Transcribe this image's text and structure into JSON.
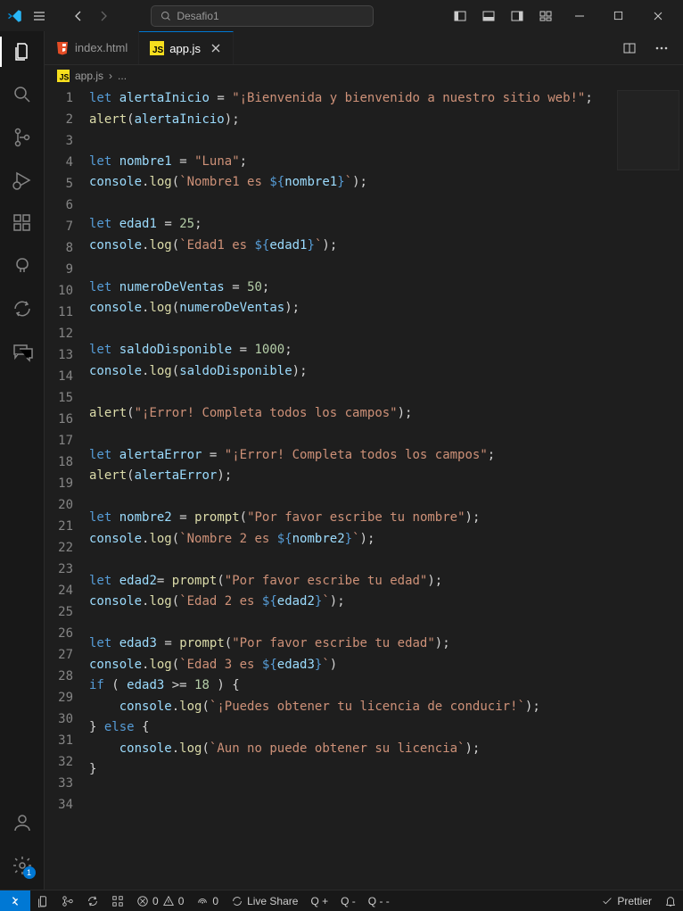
{
  "titlebar": {
    "search_text": "Desafio1"
  },
  "tabs": {
    "items": [
      {
        "label": "index.html",
        "type": "html"
      },
      {
        "label": "app.js",
        "type": "js"
      }
    ]
  },
  "breadcrumb": {
    "file": "app.js",
    "sep": "›",
    "rest": "..."
  },
  "code_lines": [
    {
      "n": 1,
      "tokens": [
        [
          "key",
          "let"
        ],
        [
          "pun",
          " "
        ],
        [
          "var",
          "alertaInicio"
        ],
        [
          "pun",
          " "
        ],
        [
          "op",
          "="
        ],
        [
          "pun",
          " "
        ],
        [
          "str",
          "\"¡Bienvenida y bienvenido a nuestro sitio web!\""
        ],
        [
          "pun",
          ";"
        ]
      ]
    },
    {
      "n": 2,
      "tokens": [
        [
          "fn",
          "alert"
        ],
        [
          "pun",
          "("
        ],
        [
          "var",
          "alertaInicio"
        ],
        [
          "pun",
          ")"
        ],
        [
          "pun",
          ";"
        ]
      ]
    },
    {
      "n": 3,
      "tokens": []
    },
    {
      "n": 4,
      "tokens": [
        [
          "key",
          "let"
        ],
        [
          "pun",
          " "
        ],
        [
          "var",
          "nombre1"
        ],
        [
          "pun",
          " "
        ],
        [
          "op",
          "="
        ],
        [
          "pun",
          " "
        ],
        [
          "str",
          "\"Luna\""
        ],
        [
          "pun",
          ";"
        ]
      ]
    },
    {
      "n": 5,
      "tokens": [
        [
          "var",
          "console"
        ],
        [
          "pun",
          "."
        ],
        [
          "fn",
          "log"
        ],
        [
          "pun",
          "("
        ],
        [
          "str",
          "`Nombre1 es "
        ],
        [
          "key",
          "${"
        ],
        [
          "var",
          "nombre1"
        ],
        [
          "key",
          "}"
        ],
        [
          "str",
          "`"
        ],
        [
          "pun",
          ")"
        ],
        [
          "pun",
          ";"
        ]
      ]
    },
    {
      "n": 6,
      "tokens": []
    },
    {
      "n": 7,
      "tokens": [
        [
          "key",
          "let"
        ],
        [
          "pun",
          " "
        ],
        [
          "var",
          "edad1"
        ],
        [
          "pun",
          " "
        ],
        [
          "op",
          "="
        ],
        [
          "pun",
          " "
        ],
        [
          "num",
          "25"
        ],
        [
          "pun",
          ";"
        ]
      ]
    },
    {
      "n": 8,
      "tokens": [
        [
          "var",
          "console"
        ],
        [
          "pun",
          "."
        ],
        [
          "fn",
          "log"
        ],
        [
          "pun",
          "("
        ],
        [
          "str",
          "`Edad1 es "
        ],
        [
          "key",
          "${"
        ],
        [
          "var",
          "edad1"
        ],
        [
          "key",
          "}"
        ],
        [
          "str",
          "`"
        ],
        [
          "pun",
          ")"
        ],
        [
          "pun",
          ";"
        ]
      ]
    },
    {
      "n": 9,
      "tokens": []
    },
    {
      "n": 10,
      "tokens": [
        [
          "key",
          "let"
        ],
        [
          "pun",
          " "
        ],
        [
          "var",
          "numeroDeVentas"
        ],
        [
          "pun",
          " "
        ],
        [
          "op",
          "="
        ],
        [
          "pun",
          " "
        ],
        [
          "num",
          "50"
        ],
        [
          "pun",
          ";"
        ]
      ]
    },
    {
      "n": 11,
      "tokens": [
        [
          "var",
          "console"
        ],
        [
          "pun",
          "."
        ],
        [
          "fn",
          "log"
        ],
        [
          "pun",
          "("
        ],
        [
          "var",
          "numeroDeVentas"
        ],
        [
          "pun",
          ")"
        ],
        [
          "pun",
          ";"
        ]
      ]
    },
    {
      "n": 12,
      "tokens": []
    },
    {
      "n": 13,
      "tokens": [
        [
          "key",
          "let"
        ],
        [
          "pun",
          " "
        ],
        [
          "var",
          "saldoDisponible"
        ],
        [
          "pun",
          " "
        ],
        [
          "op",
          "="
        ],
        [
          "pun",
          " "
        ],
        [
          "num",
          "1000"
        ],
        [
          "pun",
          ";"
        ]
      ]
    },
    {
      "n": 14,
      "tokens": [
        [
          "var",
          "console"
        ],
        [
          "pun",
          "."
        ],
        [
          "fn",
          "log"
        ],
        [
          "pun",
          "("
        ],
        [
          "var",
          "saldoDisponible"
        ],
        [
          "pun",
          ")"
        ],
        [
          "pun",
          ";"
        ]
      ]
    },
    {
      "n": 15,
      "tokens": []
    },
    {
      "n": 16,
      "tokens": [
        [
          "fn",
          "alert"
        ],
        [
          "pun",
          "("
        ],
        [
          "str",
          "\"¡Error! Completa todos los campos\""
        ],
        [
          "pun",
          ")"
        ],
        [
          "pun",
          ";"
        ]
      ]
    },
    {
      "n": 17,
      "tokens": []
    },
    {
      "n": 18,
      "tokens": [
        [
          "key",
          "let"
        ],
        [
          "pun",
          " "
        ],
        [
          "var",
          "alertaError"
        ],
        [
          "pun",
          " "
        ],
        [
          "op",
          "="
        ],
        [
          "pun",
          " "
        ],
        [
          "str",
          "\"¡Error! Completa todos los campos\""
        ],
        [
          "pun",
          ";"
        ]
      ]
    },
    {
      "n": 19,
      "tokens": [
        [
          "fn",
          "alert"
        ],
        [
          "pun",
          "("
        ],
        [
          "var",
          "alertaError"
        ],
        [
          "pun",
          ")"
        ],
        [
          "pun",
          ";"
        ]
      ]
    },
    {
      "n": 20,
      "tokens": []
    },
    {
      "n": 21,
      "tokens": [
        [
          "key",
          "let"
        ],
        [
          "pun",
          " "
        ],
        [
          "var",
          "nombre2"
        ],
        [
          "pun",
          " "
        ],
        [
          "op",
          "="
        ],
        [
          "pun",
          " "
        ],
        [
          "fn",
          "prompt"
        ],
        [
          "pun",
          "("
        ],
        [
          "str",
          "\"Por favor escribe tu nombre\""
        ],
        [
          "pun",
          ")"
        ],
        [
          "pun",
          ";"
        ]
      ]
    },
    {
      "n": 22,
      "tokens": [
        [
          "var",
          "console"
        ],
        [
          "pun",
          "."
        ],
        [
          "fn",
          "log"
        ],
        [
          "pun",
          "("
        ],
        [
          "str",
          "`Nombre 2 es "
        ],
        [
          "key",
          "${"
        ],
        [
          "var",
          "nombre2"
        ],
        [
          "key",
          "}"
        ],
        [
          "str",
          "`"
        ],
        [
          "pun",
          ")"
        ],
        [
          "pun",
          ";"
        ]
      ]
    },
    {
      "n": 23,
      "tokens": []
    },
    {
      "n": 24,
      "tokens": [
        [
          "key",
          "let"
        ],
        [
          "pun",
          " "
        ],
        [
          "var",
          "edad2"
        ],
        [
          "op",
          "="
        ],
        [
          "pun",
          " "
        ],
        [
          "fn",
          "prompt"
        ],
        [
          "pun",
          "("
        ],
        [
          "str",
          "\"Por favor escribe tu edad\""
        ],
        [
          "pun",
          ")"
        ],
        [
          "pun",
          ";"
        ]
      ]
    },
    {
      "n": 25,
      "tokens": [
        [
          "var",
          "console"
        ],
        [
          "pun",
          "."
        ],
        [
          "fn",
          "log"
        ],
        [
          "pun",
          "("
        ],
        [
          "str",
          "`Edad 2 es "
        ],
        [
          "key",
          "${"
        ],
        [
          "var",
          "edad2"
        ],
        [
          "key",
          "}"
        ],
        [
          "str",
          "`"
        ],
        [
          "pun",
          ")"
        ],
        [
          "pun",
          ";"
        ]
      ]
    },
    {
      "n": 26,
      "tokens": []
    },
    {
      "n": 27,
      "tokens": [
        [
          "key",
          "let"
        ],
        [
          "pun",
          " "
        ],
        [
          "var",
          "edad3"
        ],
        [
          "pun",
          " "
        ],
        [
          "op",
          "="
        ],
        [
          "pun",
          " "
        ],
        [
          "fn",
          "prompt"
        ],
        [
          "pun",
          "("
        ],
        [
          "str",
          "\"Por favor escribe tu edad\""
        ],
        [
          "pun",
          ")"
        ],
        [
          "pun",
          ";"
        ]
      ]
    },
    {
      "n": 28,
      "tokens": [
        [
          "var",
          "console"
        ],
        [
          "pun",
          "."
        ],
        [
          "fn",
          "log"
        ],
        [
          "pun",
          "("
        ],
        [
          "str",
          "`Edad 3 es "
        ],
        [
          "key",
          "${"
        ],
        [
          "var",
          "edad3"
        ],
        [
          "key",
          "}"
        ],
        [
          "str",
          "`"
        ],
        [
          "pun",
          ")"
        ]
      ]
    },
    {
      "n": 29,
      "tokens": [
        [
          "key",
          "if"
        ],
        [
          "pun",
          " ( "
        ],
        [
          "var",
          "edad3"
        ],
        [
          "pun",
          " "
        ],
        [
          "op",
          ">="
        ],
        [
          "pun",
          " "
        ],
        [
          "num",
          "18"
        ],
        [
          "pun",
          " ) {"
        ]
      ]
    },
    {
      "n": 30,
      "tokens": [
        [
          "pun",
          "    "
        ],
        [
          "var",
          "console"
        ],
        [
          "pun",
          "."
        ],
        [
          "fn",
          "log"
        ],
        [
          "pun",
          "("
        ],
        [
          "str",
          "`¡Puedes obtener tu licencia de conducir!`"
        ],
        [
          "pun",
          ")"
        ],
        [
          "pun",
          ";"
        ]
      ]
    },
    {
      "n": 31,
      "tokens": [
        [
          "pun",
          "} "
        ],
        [
          "key",
          "else"
        ],
        [
          "pun",
          " {"
        ]
      ]
    },
    {
      "n": 32,
      "tokens": [
        [
          "pun",
          "    "
        ],
        [
          "var",
          "console"
        ],
        [
          "pun",
          "."
        ],
        [
          "fn",
          "log"
        ],
        [
          "pun",
          "("
        ],
        [
          "str",
          "`Aun no puede obtener su licencia`"
        ],
        [
          "pun",
          ")"
        ],
        [
          "pun",
          ";"
        ]
      ]
    },
    {
      "n": 33,
      "tokens": [
        [
          "pun",
          "}"
        ]
      ]
    },
    {
      "n": 34,
      "tokens": []
    }
  ],
  "status": {
    "errors": "0",
    "warnings": "0",
    "port": "0",
    "liveshare": "Live Share",
    "q1": "Q +",
    "q2": "Q -",
    "q3": "Q - -",
    "prettier": "Prettier"
  },
  "settings_badge": "1"
}
